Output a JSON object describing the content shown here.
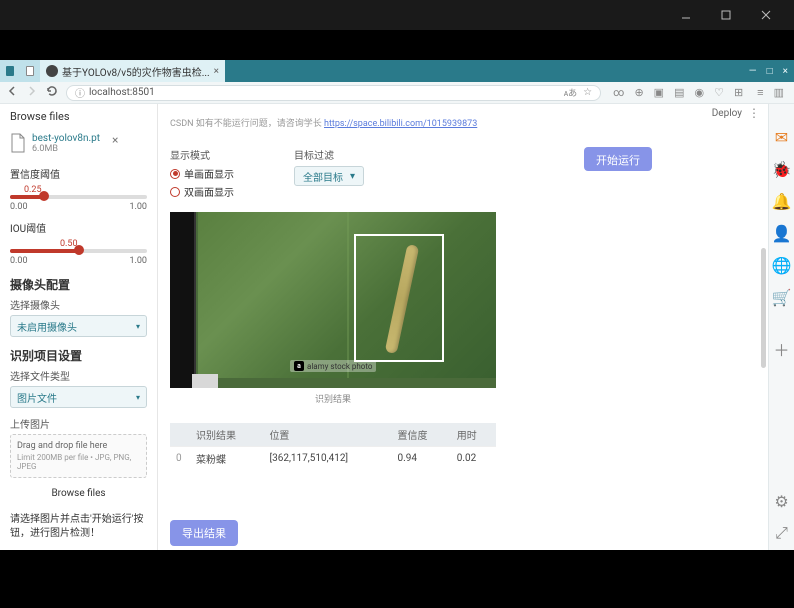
{
  "os": {
    "minimize": "—",
    "maximize": "□",
    "close": "✕"
  },
  "browser": {
    "tab_title_trunc": "基于YOLOv8/v5的灾作物害虫检...",
    "close": "×",
    "win_min": "—",
    "win_max": "□",
    "win_close": "×",
    "url": "localhost:8501",
    "star": "☆"
  },
  "deploy": "Deploy",
  "rail_icons": {
    "msg": "msg",
    "bug": "bug",
    "bell": "bell",
    "user": "user",
    "globe": "globe",
    "cart": "cart",
    "plus": "+",
    "wrench": "wrench",
    "gear": "gear"
  },
  "sidebar": {
    "browse": "Browse files",
    "file": {
      "name": "best-yolov8n.pt",
      "size": "6.0MB",
      "remove": "×"
    },
    "conf": {
      "label": "置信度阈值",
      "value": "0.25",
      "min": "0.00",
      "max": "1.00",
      "fill_pct": 25
    },
    "iou": {
      "label": "IOU阈值",
      "value": "0.50",
      "min": "0.00",
      "max": "1.00",
      "fill_pct": 50
    },
    "camera_title": "摄像头配置",
    "camera_label": "选择摄像头",
    "camera_value": "未启用摄像头",
    "project_title": "识别项目设置",
    "filetype_label": "选择文件类型",
    "filetype_value": "图片文件",
    "upload_label": "上传图片",
    "dropzone": "Drag and drop file here",
    "limit": "Limit 200MB per file • JPG, PNG, JPEG",
    "browse2": "Browse files",
    "hint": "请选择图片并点击'开始运行'按钮，进行图片检测！"
  },
  "main": {
    "trunc_text": "CSDN 如有不能运行问题，请咨询学长 ",
    "link_text": "https://space.bilibili.com/1015939873",
    "mode_label": "显示模式",
    "radio1": "单画面显示",
    "radio2": "双画面显示",
    "filter_label": "目标过滤",
    "filter_value": "全部目标",
    "run_btn": "开始运行",
    "watermark": "alamy stock photo",
    "caption": "识别结果",
    "table": {
      "headers": [
        "",
        "识别结果",
        "位置",
        "置信度",
        "用时"
      ],
      "rows": [
        {
          "idx": "0",
          "result": "菜粉蝶",
          "pos": "[362,117,510,412]",
          "conf": "0.94",
          "time": "0.02"
        }
      ]
    },
    "export_btn": "导出结果"
  }
}
